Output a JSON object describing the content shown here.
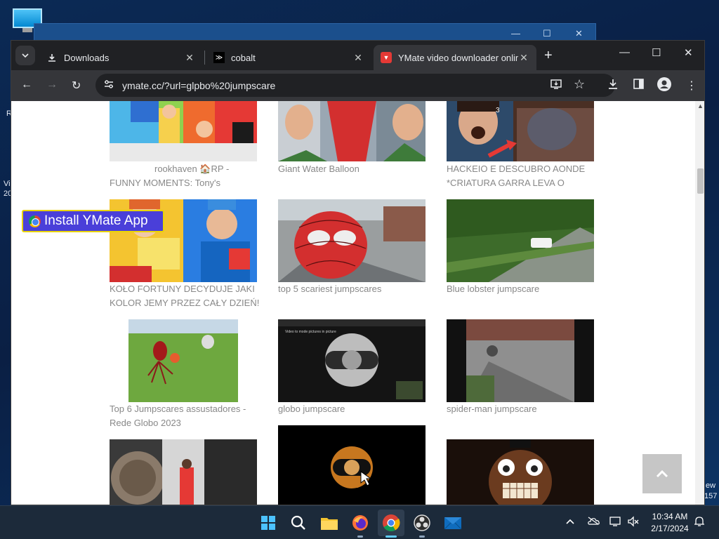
{
  "desktop": {
    "left_text_1": "R",
    "left_text_2": "Vi",
    "left_text_3": "20",
    "right_text_1": "ew",
    "right_text_2": "157"
  },
  "tabs": [
    {
      "title": "Downloads",
      "icon": "download-icon"
    },
    {
      "title": "cobalt",
      "icon": "cobalt-icon"
    },
    {
      "title": "YMate video downloader online",
      "icon": "ymate-icon",
      "active": true
    }
  ],
  "omnibox": {
    "url": "ymate.cc/?url=glpbo%20jumpscare"
  },
  "install_button": {
    "label": "Install YMate App"
  },
  "videos": [
    {
      "line1": "rookhaven 🏠RP -",
      "line2": "FUNNY MOMENTS: Tony's"
    },
    {
      "line1": "Giant Water Balloon",
      "line2": ""
    },
    {
      "line1": "HACKEIO E DESCUBRO AONDE",
      "line2": "*CRIATURA GARRA LEVA O"
    },
    {
      "line1": "KOŁO FORTUNY DECYDUJE JAKI",
      "line2": "KOLOR JEMY PRZEZ CAŁY DZIEŃ!"
    },
    {
      "line1": "top 5 scariest jumpscares",
      "line2": ""
    },
    {
      "line1": "Blue lobster jumpscare",
      "line2": ""
    },
    {
      "line1": "Top 6 Jumpscares assustadores -",
      "line2": "Rede Globo 2023"
    },
    {
      "line1": "globo jumpscare",
      "line2": ""
    },
    {
      "line1": "spider-man jumpscare",
      "line2": ""
    },
    {
      "line1": "",
      "line2": ""
    },
    {
      "line1": "",
      "line2": ""
    },
    {
      "line1": "",
      "line2": ""
    }
  ],
  "thumb_overlay_text": {
    "globo_title": "Video to mode pictures in picture",
    "hack_num": "3"
  },
  "taskbar": {
    "time": "10:34 AM",
    "date": "2/17/2024"
  },
  "colors": {
    "caption": "#888888",
    "install_bg": "#4a3fd9",
    "install_border": "#e9d400"
  }
}
